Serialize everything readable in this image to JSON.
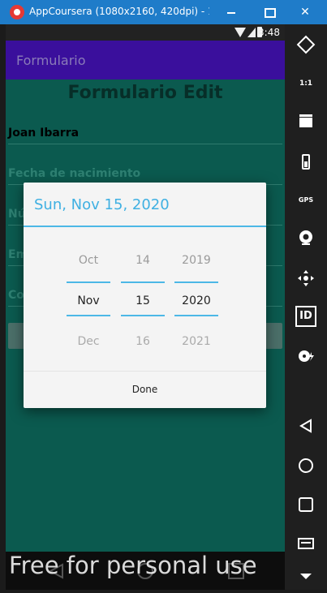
{
  "window": {
    "title": "AppCoursera (1080x2160, 420dpi) - 192.1...",
    "buttons": {
      "minimize": "",
      "maximize": "",
      "close": "✕"
    }
  },
  "statusbar": {
    "time": "3:48"
  },
  "appbar": {
    "title": "Formulario"
  },
  "form": {
    "heading": "Formulario Edit",
    "name_value": "Joan Ibarra",
    "birthdate_hint": "Fecha de nacimiento",
    "phone_hint_visible": "Nú",
    "email_hint_visible": "Em",
    "description_hint_visible": "Co"
  },
  "date_picker": {
    "header_date": "Sun, Nov 15, 2020",
    "month": {
      "prev": "Oct",
      "current": "Nov",
      "next": "Dec"
    },
    "day": {
      "prev": "14",
      "current": "15",
      "next": "16"
    },
    "year": {
      "prev": "2019",
      "current": "2020",
      "next": "2021"
    },
    "done_label": "Done"
  },
  "watermark": "Free for personal use",
  "side_panel": {
    "gps_label": "GPS",
    "id_label": "ID",
    "ratio_label": "1:1"
  },
  "colors": {
    "titlebar": "#1f7cc9",
    "appbar": "#3a0f9c",
    "background": "#0b5a4f",
    "accent": "#4cb8e6"
  }
}
